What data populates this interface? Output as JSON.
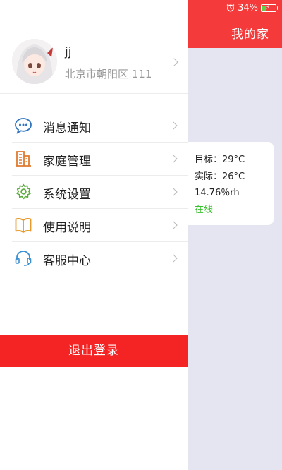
{
  "status": {
    "battery": "34%",
    "battery_level": 0.34,
    "icons": [
      "alarm-icon",
      "battery-icon"
    ]
  },
  "header": {
    "title": "我的家"
  },
  "device": {
    "target": "目标：29°C",
    "actual": "实际：26°C",
    "humidity": "14.76％rh",
    "state": "在线"
  },
  "profile": {
    "name": "jj",
    "address": "北京市朝阳区 111"
  },
  "menu": {
    "items": [
      {
        "label": "消息通知",
        "icon": "message-icon"
      },
      {
        "label": "家庭管理",
        "icon": "building-icon"
      },
      {
        "label": "系统设置",
        "icon": "settings-gear-icon"
      },
      {
        "label": "使用说明",
        "icon": "book-icon"
      },
      {
        "label": "客服中心",
        "icon": "headset-icon"
      }
    ]
  },
  "logout": {
    "label": "退出登录"
  },
  "colors": {
    "accent": "#f43a3a",
    "logout": "#f42424",
    "online": "#37c12c",
    "panel": "#e4e5f0"
  }
}
